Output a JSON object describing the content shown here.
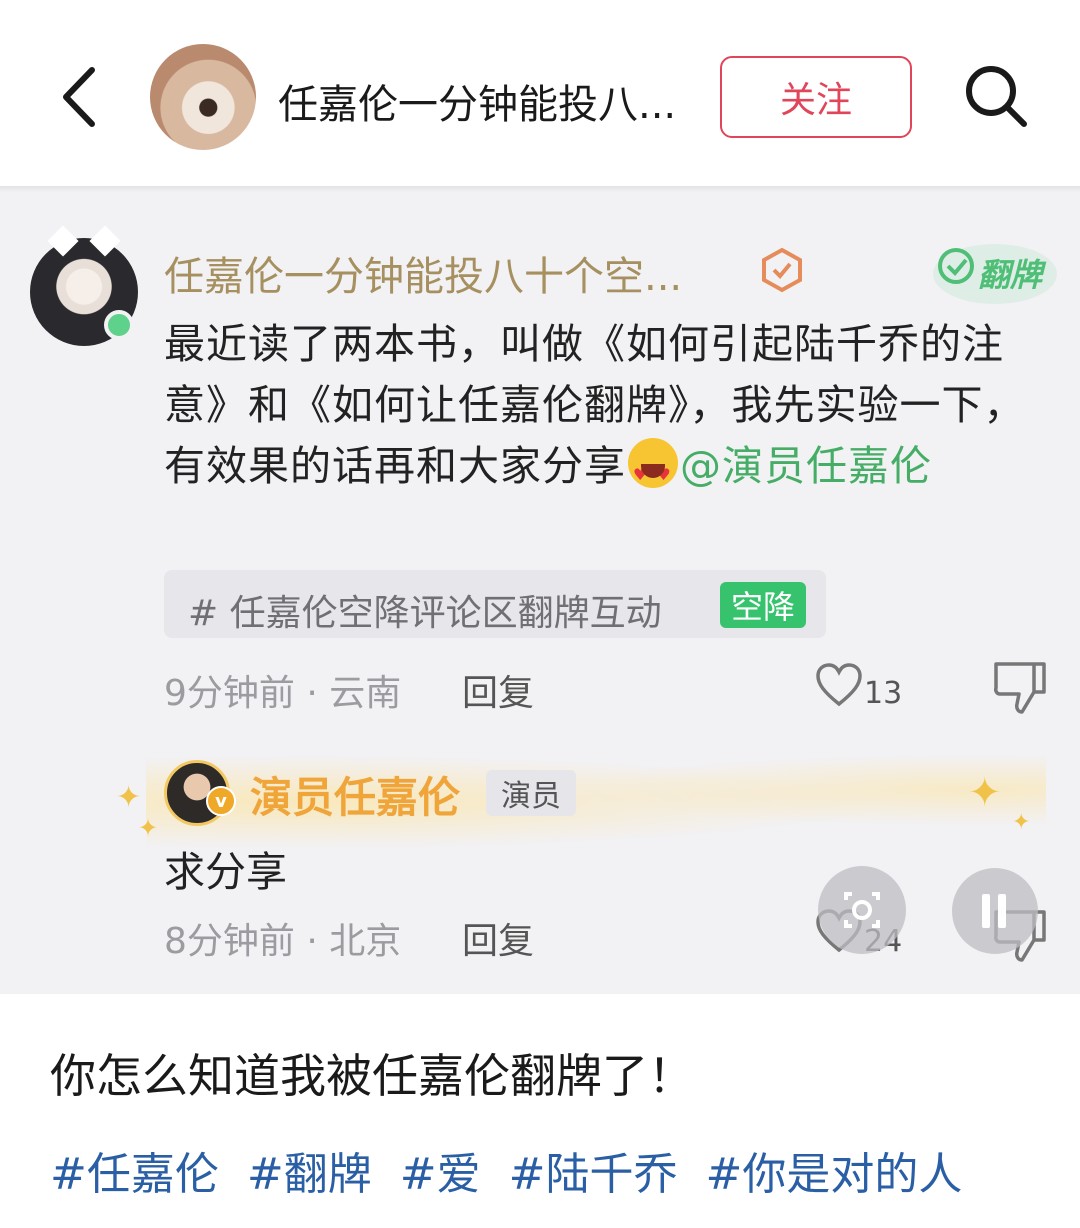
{
  "header": {
    "title": "任嘉伦一分钟能投八...",
    "follow_label": "关注"
  },
  "comment": {
    "username": "任嘉伦一分钟能投八十个空...",
    "flip_tag": "翻牌",
    "text_before_emoji": "最近读了两本书，叫做《如何引起陆千乔的注意》和《如何让任嘉伦翻牌》，我先实验一下，有效果的话再和大家分享",
    "emoji": "heart-eyes-emoji",
    "mention": "@演员任嘉伦",
    "topic": "# 任嘉伦空降评论区翻牌互动",
    "topic_tag": "空降",
    "time_location": "9分钟前 · 云南",
    "reply_label": "回复",
    "like_count": "13"
  },
  "reply": {
    "username": "演员任嘉伦",
    "verified": "v",
    "role": "演员",
    "text": "求分享",
    "time_location": "8分钟前 · 北京",
    "reply_label": "回复",
    "like_count": "24"
  },
  "post": {
    "caption": "你怎么知道我被任嘉伦翻牌了！",
    "hashtags": [
      "#任嘉伦",
      "#翻牌",
      "#爱",
      "#陆千乔",
      "#你是对的人"
    ]
  },
  "colors": {
    "follow_accent": "#e0455a",
    "mention_green": "#46ad66",
    "reply_gold": "#f0a53a",
    "hashtag_blue": "#2a5fa5"
  }
}
